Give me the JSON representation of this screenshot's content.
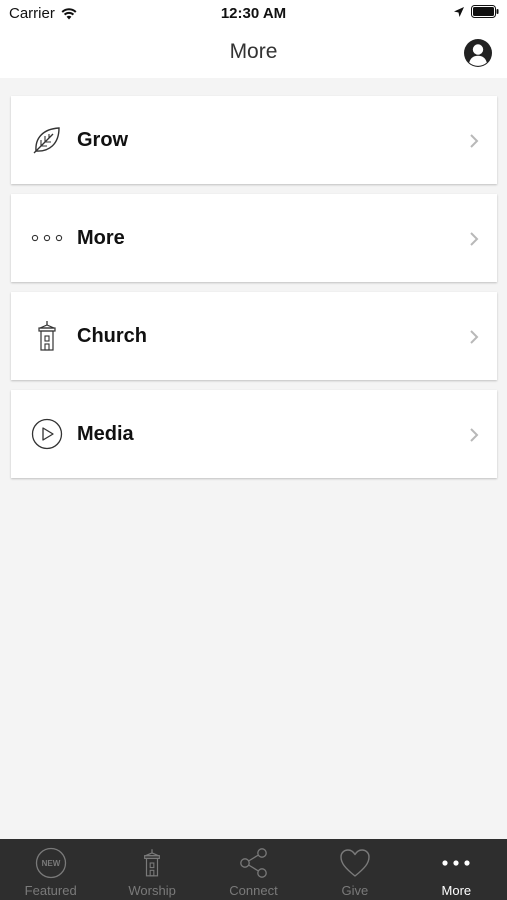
{
  "status_bar": {
    "carrier": "Carrier",
    "time": "12:30 AM"
  },
  "header": {
    "title": "More",
    "profile_icon": "person-circle-icon"
  },
  "menu": {
    "items": [
      {
        "label": "Grow",
        "icon": "leaf-icon"
      },
      {
        "label": "More",
        "icon": "ellipsis-icon"
      },
      {
        "label": "Church",
        "icon": "church-icon"
      },
      {
        "label": "Media",
        "icon": "play-icon"
      }
    ]
  },
  "tab_bar": {
    "tabs": [
      {
        "label": "Featured",
        "icon": "new-badge-icon",
        "badge_text": "NEW"
      },
      {
        "label": "Worship",
        "icon": "church-icon"
      },
      {
        "label": "Connect",
        "icon": "share-icon"
      },
      {
        "label": "Give",
        "icon": "heart-icon"
      },
      {
        "label": "More",
        "icon": "ellipsis-icon",
        "active": true
      }
    ]
  },
  "colors": {
    "background": "#f4f4f4",
    "tab_bar": "#2e2e2e",
    "tab_inactive": "#7a7a7a",
    "tab_active": "#ffffff"
  }
}
